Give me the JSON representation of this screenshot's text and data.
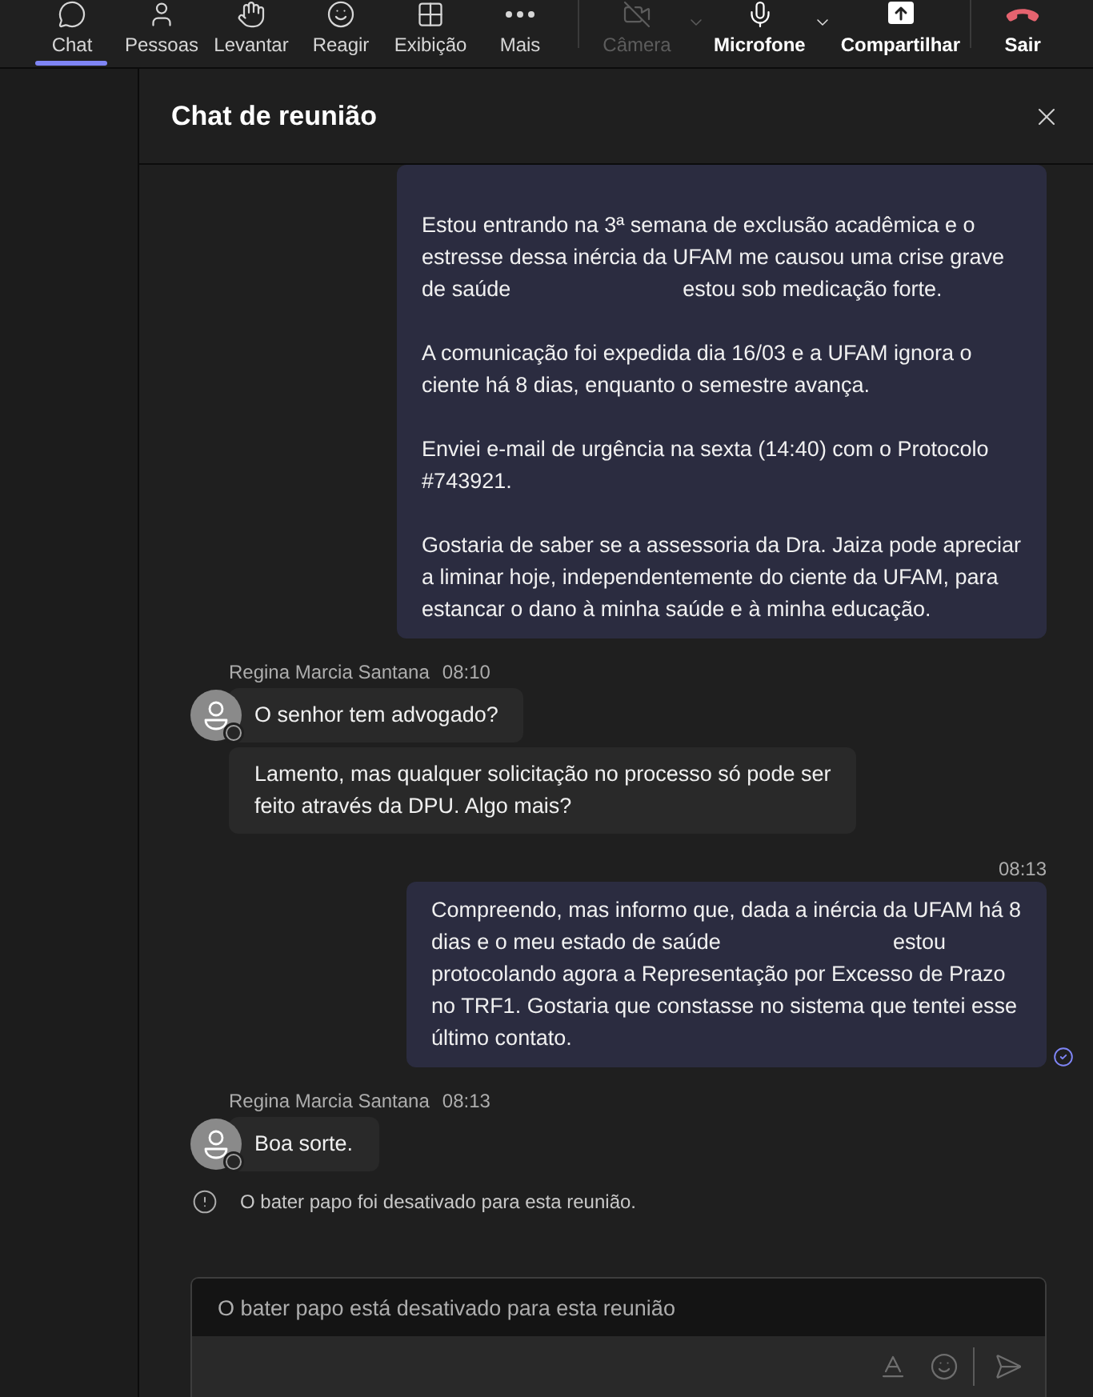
{
  "toolbar": {
    "view_controls": [
      {
        "label": "Chat",
        "selected": true
      },
      {
        "label": "Pessoas",
        "selected": false
      },
      {
        "label": "Levantar",
        "selected": false
      },
      {
        "label": "Reagir",
        "selected": false
      },
      {
        "label": "Exibição",
        "selected": false
      },
      {
        "label": "Mais",
        "selected": false
      }
    ],
    "call_controls": [
      {
        "label": "Câmera",
        "disabled": true,
        "has_menu": true
      },
      {
        "label": "Microfone",
        "disabled": false,
        "has_menu": true
      },
      {
        "label": "Compartilhar",
        "disabled": false,
        "has_menu": false
      }
    ],
    "leave_button": {
      "label": "Sair"
    }
  },
  "chat_panel": {
    "title": "Chat de reunião",
    "messages": [
      {
        "kind": "outgoing",
        "read": false,
        "paragraphs": [
          {
            "lines": [
              [
                "Estou entrando na 3ª semana de exclusão acadêmica e o"
              ],
              [
                "estresse dessa inércia da UFAM me causou uma crise grave"
              ],
              [
                "de saúde",
                "estou sob medicação forte."
              ]
            ]
          },
          {
            "lines": [
              [
                "A comunicação foi expedida dia 16/03 e a UFAM ignora o"
              ],
              [
                "ciente há 8 dias, enquanto o semestre avança."
              ]
            ]
          },
          {
            "lines": [
              [
                "Enviei e-mail de urgência na sexta (14:40) com o Protocolo"
              ],
              [
                "#743921."
              ]
            ]
          },
          {
            "lines": [
              [
                "Gostaria de saber se a assessoria da Dra. Jaiza pode apreciar"
              ],
              [
                "a liminar hoje, independentemente do ciente da UFAM, para"
              ],
              [
                "estancar o dano à minha saúde e à minha educação."
              ]
            ]
          }
        ]
      },
      {
        "kind": "incoming",
        "sender": "Regina Marcia Santana",
        "time": "08:10",
        "bubbles": [
          {
            "lines": [
              "O senhor tem advogado?"
            ]
          },
          {
            "lines": [
              "Lamento, mas qualquer solicitação no processo só pode ser",
              "feito através da DPU. Algo mais?"
            ]
          }
        ]
      },
      {
        "kind": "outgoing",
        "time": "08:13",
        "read": true,
        "paragraphs": [
          {
            "lines": [
              [
                "Compreendo, mas informo que, dada a inércia da UFAM há 8"
              ],
              [
                "dias e o meu estado de saúde",
                "estou"
              ],
              [
                "protocolando agora a Representação por Excesso de Prazo"
              ],
              [
                "no TRF1. Gostaria que constasse no sistema que tentei esse"
              ],
              [
                "último contato."
              ]
            ]
          }
        ]
      },
      {
        "kind": "incoming",
        "sender": "Regina Marcia Santana",
        "time": "08:13",
        "bubbles": [
          {
            "lines": [
              "Boa sorte."
            ]
          }
        ]
      },
      {
        "kind": "system",
        "text": "O bater papo foi desativado para esta reunião."
      }
    ],
    "composer": {
      "placeholder": "O bater papo está desativado para esta reunião",
      "disabled": true
    }
  }
}
